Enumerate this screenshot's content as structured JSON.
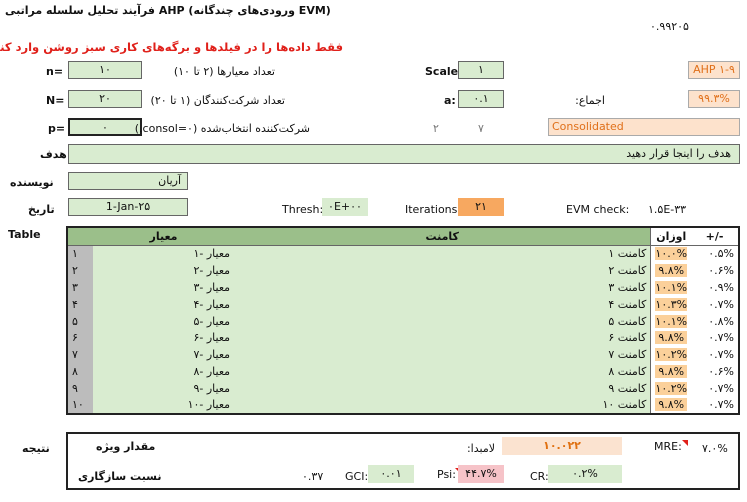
{
  "title": "فرآیند تحلیل سلسله مراتبی AHP (ورودی‌های چندگانه EVM)",
  "top_value": "۰.۹۹۲۰۵",
  "warning": "فقط داده‌ها را در فیلدها و برگه‌های کاری سبز روشن وارد کنید!",
  "params": {
    "n_label": "n=",
    "n_value": "۱۰",
    "n_desc": "تعداد معیارها (۲ تا ۱۰)",
    "N_label": "N=",
    "N_value": "۲۰",
    "N_desc": "تعداد شرکت‌کنندگان (۱ تا ۲۰)",
    "p_label": "p=",
    "p_value": "۰",
    "p_desc": "شرکت‌کننده انتخاب‌شده (۰=consol.)",
    "scale_label": "Scale:",
    "scale_value": "۱",
    "a_label": "a:",
    "a_value": "۰.۱",
    "num7": "۷",
    "num2": "۲",
    "ahp_label": "AHP ۱-۹",
    "consensus_label": "اجماع:",
    "consensus_value": "۹۹.۳%",
    "consolidated": "Consolidated"
  },
  "goal_label": "هدف",
  "goal_value": "هدف را اینجا قرار دهید",
  "author_label": "نویسنده",
  "author_value": "آریان",
  "date_label": "تاریخ",
  "date_value": "1-Jan-۲۵",
  "thresh_label": "Thresh:",
  "thresh_value": "۰E+۰۰",
  "iter_label": "Iterations:",
  "iter_value": "۲۱",
  "evm_label": "EVM check:",
  "evm_value": "۱.۵E-۳۳",
  "table": {
    "label": "Table",
    "col_criteria": "معیار",
    "col_comment": "کامنت",
    "col_weights": "اوزان",
    "col_pm": "+/-",
    "rows": [
      {
        "idx": "۱",
        "crit": "معیار -۱",
        "comment": "کامنت ۱",
        "w": "۱۰.۰%",
        "pm": "۰.۵%"
      },
      {
        "idx": "۲",
        "crit": "معیار -۲",
        "comment": "کامنت ۲",
        "w": "۹.۸%",
        "pm": "۰.۶%"
      },
      {
        "idx": "۳",
        "crit": "معیار -۳",
        "comment": "کامنت ۳",
        "w": "۱۰.۱%",
        "pm": "۰.۹%"
      },
      {
        "idx": "۴",
        "crit": "معیار -۴",
        "comment": "کامنت ۴",
        "w": "۱۰.۳%",
        "pm": "۰.۷%"
      },
      {
        "idx": "۵",
        "crit": "معیار -۵",
        "comment": "کامنت ۵",
        "w": "۱۰.۱%",
        "pm": "۰.۸%"
      },
      {
        "idx": "۶",
        "crit": "معیار -۶",
        "comment": "کامنت ۶",
        "w": "۹.۸%",
        "pm": "۰.۷%"
      },
      {
        "idx": "۷",
        "crit": "معیار -۷",
        "comment": "کامنت ۷",
        "w": "۱۰.۲%",
        "pm": "۰.۷%"
      },
      {
        "idx": "۸",
        "crit": "معیار -۸",
        "comment": "کامنت ۸",
        "w": "۹.۸%",
        "pm": "۰.۶%"
      },
      {
        "idx": "۹",
        "crit": "معیار -۹",
        "comment": "کامنت ۹",
        "w": "۱۰.۲%",
        "pm": "۰.۷%"
      },
      {
        "idx": "۱۰",
        "crit": "معیار -۱۰",
        "comment": "کامنت ۱۰",
        "w": "۹.۸%",
        "pm": "۰.۷%"
      }
    ]
  },
  "result": {
    "label": "نتیجه",
    "eigen_label": "مقدار ویژه",
    "lambda_label": "لامبدا:",
    "lambda_value": "۱۰.۰۲۲",
    "mre_label": "MRE:",
    "mre_value": "۷.۰%",
    "consistency_label": "نسبت سازگاری",
    "cons_value": "۰.۳۷",
    "gci_label": "GCI:",
    "gci_value": "۰.۰۱",
    "psi_label": "Psi:",
    "psi_value": "۴۴.۷%",
    "cr_label": "CR:",
    "cr_value": "۰.۲%"
  }
}
